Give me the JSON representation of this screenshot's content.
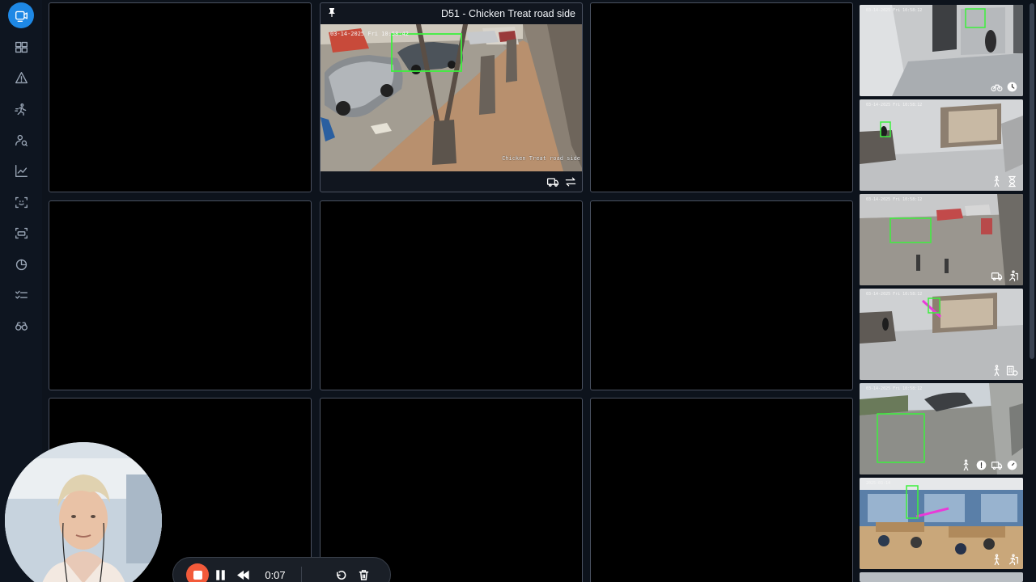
{
  "sidebar": {
    "items": [
      {
        "icon": "video-wall-icon",
        "active": true
      },
      {
        "icon": "grid-layout-icon",
        "active": false
      },
      {
        "icon": "alert-triangle-icon",
        "active": false
      },
      {
        "icon": "running-person-icon",
        "active": false
      },
      {
        "icon": "person-search-icon",
        "active": false
      },
      {
        "icon": "line-chart-icon",
        "active": false
      },
      {
        "icon": "face-scan-icon",
        "active": false
      },
      {
        "icon": "plate-scan-icon",
        "active": false
      },
      {
        "icon": "pie-chart-icon",
        "active": false
      },
      {
        "icon": "checklist-icon",
        "active": false
      },
      {
        "icon": "binoculars-icon",
        "active": false
      }
    ]
  },
  "grid": {
    "featured": {
      "title": "D51 - Chicken Treat road side",
      "osd_label": "Chicken Treat road side",
      "osd_time": "03-14-2025 Fri 10:58:42",
      "footer_icons": [
        "vehicle-icon",
        "swap-icon"
      ]
    }
  },
  "thumbs": [
    {
      "osd_time": "03-14-2025 Fri 10:58:12",
      "icons": [
        "bicycle-icon",
        "clock-icon"
      ]
    },
    {
      "osd_time": "03-14-2025 Fri 10:58:12",
      "icons": [
        "walking-person-icon",
        "hourglass-icon"
      ]
    },
    {
      "osd_time": "03-14-2025 Fri 10:58:12",
      "icons": [
        "vehicle-icon",
        "running-exit-icon"
      ]
    },
    {
      "osd_time": "03-14-2025 Fri 10:58:12",
      "icons": [
        "walking-person-icon",
        "building-alert-icon"
      ]
    },
    {
      "osd_time": "03-14-2025 Fri 10:58:12",
      "icons": [
        "walking-person-icon",
        "info-icon",
        "vehicle-icon",
        "speed-icon"
      ]
    },
    {
      "osd_time": "2025-03-14",
      "icons": [
        "walking-person-icon",
        "running-exit-icon"
      ]
    }
  ],
  "recorder": {
    "elapsed": "0:07"
  }
}
